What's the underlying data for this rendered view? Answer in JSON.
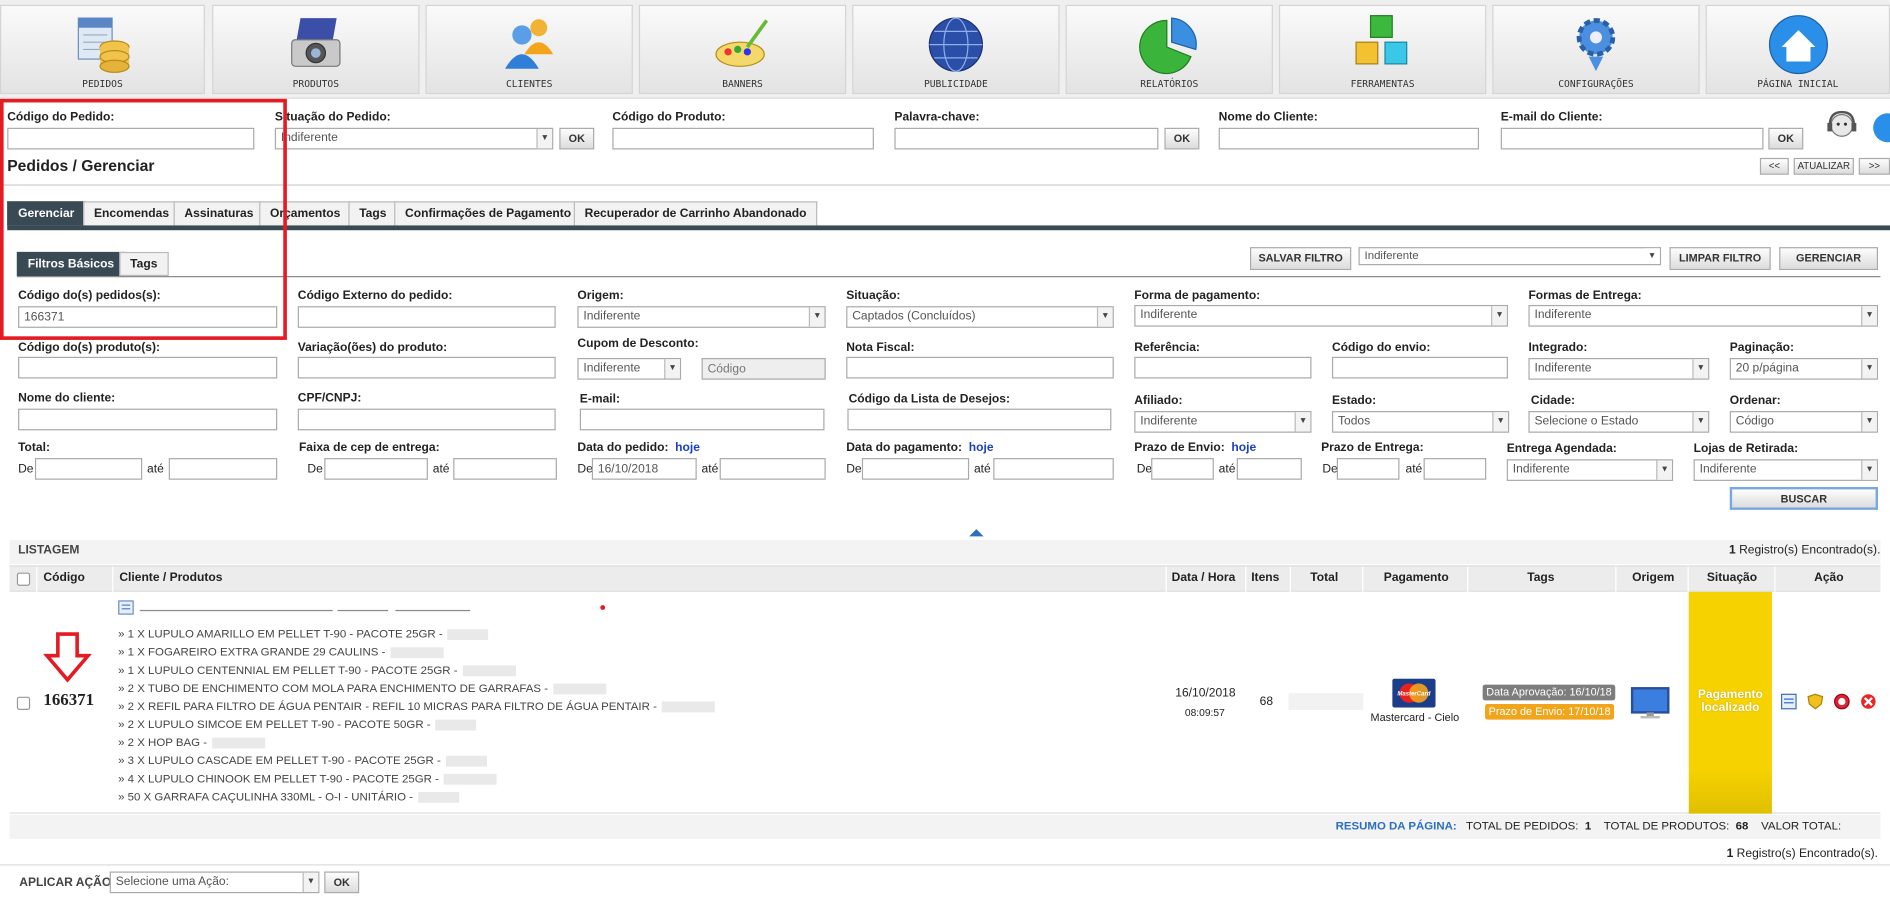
{
  "nav": {
    "items": [
      {
        "label": "PEDIDOS",
        "icon": "orders-database-icon"
      },
      {
        "label": "PRODUTOS",
        "icon": "camera-icon"
      },
      {
        "label": "CLIENTES",
        "icon": "users-icon"
      },
      {
        "label": "BANNERS",
        "icon": "paint-palette-icon"
      },
      {
        "label": "PUBLICIDADE",
        "icon": "globe-icon"
      },
      {
        "label": "RELATÓRIOS",
        "icon": "pie-chart-icon"
      },
      {
        "label": "FERRAMENTAS",
        "icon": "cubes-icon"
      },
      {
        "label": "CONFIGURAÇÕES",
        "icon": "gear-icon"
      },
      {
        "label": "PÁGINA INICIAL",
        "icon": "home-icon"
      }
    ]
  },
  "quicksearch": {
    "order_code_label": "Código do Pedido:",
    "order_status_label": "Situação do Pedido:",
    "order_status_value": "Indiferente",
    "product_code_label": "Código do Produto:",
    "keyword_label": "Palavra-chave:",
    "customer_name_label": "Nome do Cliente:",
    "customer_email_label": "E-mail do Cliente:",
    "ok": "OK"
  },
  "page": {
    "title": "Pedidos / Gerenciar",
    "prev": "<<",
    "refresh": "ATUALIZAR",
    "next": ">>"
  },
  "tabs": [
    "Gerenciar",
    "Encomendas",
    "Assinaturas",
    "Orçamentos",
    "Tags",
    "Confirmações de Pagamento",
    "Recuperador de Carrinho Abandonado"
  ],
  "subtabs": [
    "Filtros Básicos",
    "Tags"
  ],
  "filter_toolbar": {
    "save_filter": "SALVAR FILTRO",
    "saved_filter_value": "Indiferente",
    "clear_filter": "LIMPAR FILTRO",
    "manage": "GERENCIAR"
  },
  "filters": {
    "order_codes_label": "Código do(s) pedidos(s):",
    "order_codes_value": "166371",
    "external_code_label": "Código Externo do pedido:",
    "origin_label": "Origem:",
    "origin_value": "Indiferente",
    "status_label": "Situação:",
    "status_value": "Captados (Concluídos)",
    "payment_method_label": "Forma de pagamento:",
    "payment_method_value": "Indiferente",
    "shipping_methods_label": "Formas de Entrega:",
    "shipping_methods_value": "Indiferente",
    "product_codes_label": "Código do(s) produto(s):",
    "product_variations_label": "Variação(ões) do produto:",
    "coupon_label": "Cupom de Desconto:",
    "coupon_value": "Indiferente",
    "coupon_code_placeholder": "Código",
    "invoice_label": "Nota Fiscal:",
    "reference_label": "Referência:",
    "shipping_code_label": "Código do envio:",
    "integrated_label": "Integrado:",
    "integrated_value": "Indiferente",
    "pagination_label": "Paginação:",
    "pagination_value": "20 p/página",
    "customer_name_label": "Nome do cliente:",
    "cpf_label": "CPF/CNPJ:",
    "email_label": "E-mail:",
    "wishlist_label": "Código da Lista de Desejos:",
    "affiliate_label": "Afiliado:",
    "affiliate_value": "Indiferente",
    "state_label": "Estado:",
    "state_value": "Todos",
    "city_label": "Cidade:",
    "city_value": "Selecione o Estado",
    "order_by_label": "Ordenar:",
    "order_by_value": "Código",
    "total_label": "Total:",
    "zip_range_label": "Faixa de cep de entrega:",
    "order_date_label": "Data do pedido:",
    "order_date_from": "16/10/2018",
    "payment_date_label": "Data do pagamento:",
    "ship_deadline_label": "Prazo de Envio:",
    "delivery_deadline_label": "Prazo de Entrega:",
    "scheduled_delivery_label": "Entrega Agendada:",
    "scheduled_delivery_value": "Indiferente",
    "pickup_stores_label": "Lojas de Retirada:",
    "pickup_stores_value": "Indiferente",
    "from": "De",
    "to": "até",
    "today": "hoje",
    "search": "BUSCAR"
  },
  "listing": {
    "title": "LISTAGEM",
    "records": "1 Registro(s) Encontrado(s).",
    "columns": [
      "Código",
      "Cliente / Produtos",
      "Data / Hora",
      "Itens",
      "Total",
      "Pagamento",
      "Tags",
      "Origem",
      "Situação",
      "Ação"
    ]
  },
  "order": {
    "code": "166371",
    "products": [
      "» 1 X LUPULO AMARILLO EM PELLET T-90 - PACOTE 25GR -",
      "» 1 X FOGAREIRO EXTRA GRANDE 29 CAULINS -",
      "» 1 X LUPULO CENTENNIAL EM PELLET T-90 - PACOTE 25GR -",
      "» 2 X TUBO DE ENCHIMENTO COM MOLA PARA ENCHIMENTO DE GARRAFAS -",
      "» 2 X REFIL PARA FILTRO DE ÁGUA PENTAIR - REFIL 10 MICRAS PARA FILTRO DE ÁGUA PENTAIR -",
      "» 2 X LUPULO SIMCOE EM PELLET T-90 - PACOTE 50GR -",
      "» 2 X HOP BAG -",
      "» 3 X LUPULO CASCADE EM PELLET T-90 - PACOTE 25GR -",
      "» 4 X LUPULO CHINOOK EM PELLET T-90 - PACOTE 25GR -",
      "» 50 X GARRAFA CAÇULINHA 330ML - O-I - UNITÁRIO -"
    ],
    "date": "16/10/2018",
    "time": "08:09:57",
    "items": "68",
    "payment_label": "Mastercard - Cielo",
    "card_brand": "MasterCard",
    "tag_approval": "Data Aprovação: 16/10/18",
    "tag_shipping": "Prazo de Envio: 17/10/18",
    "status": "Pagamento localizado",
    "status_color": "#f6d200"
  },
  "summary": {
    "label": "RESUMO DA PÁGINA:",
    "total_orders_label": "TOTAL DE PEDIDOS:",
    "total_orders": "1",
    "total_products_label": "TOTAL DE PRODUTOS:",
    "total_products": "68",
    "total_value_label": "VALOR TOTAL:"
  },
  "footer": {
    "records": "1 Registro(s) Encontrado(s).",
    "apply_action_label": "APLICAR AÇÃO:",
    "action_value": "Selecione uma Ação:",
    "ok": "OK"
  }
}
